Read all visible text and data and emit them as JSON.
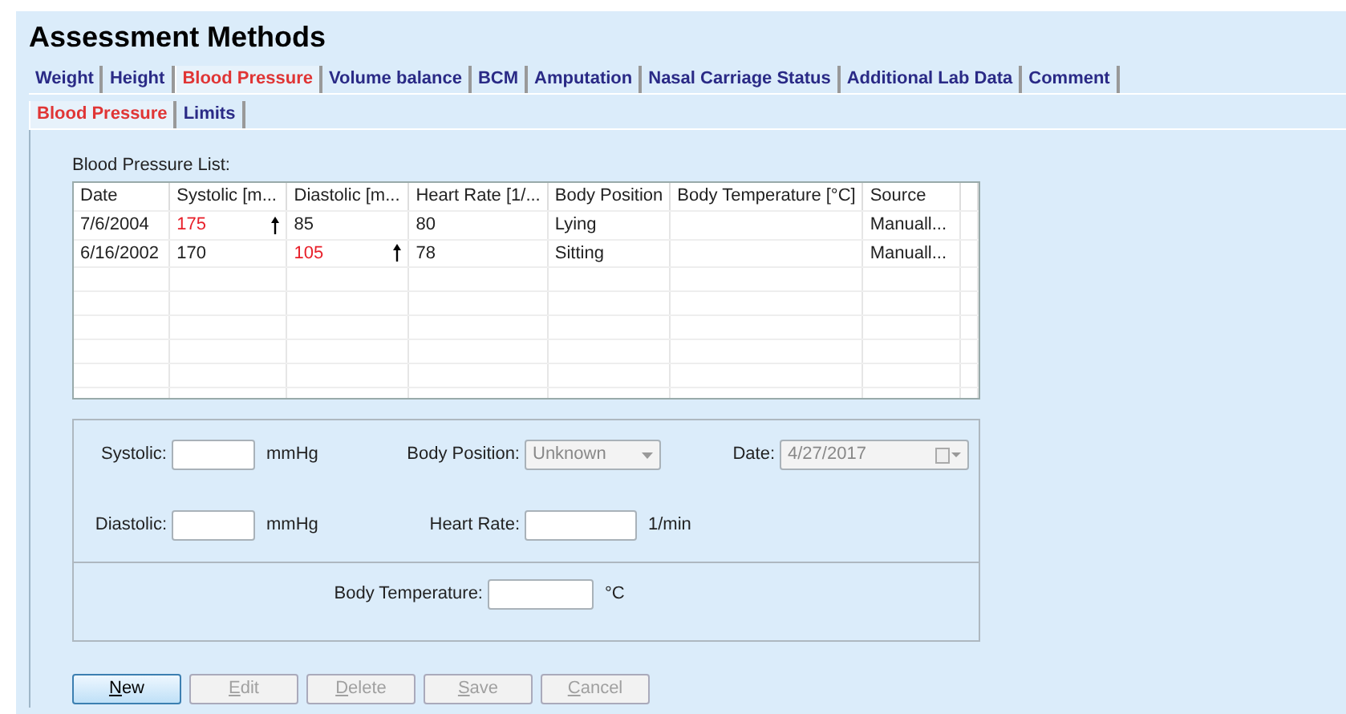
{
  "title": "Assessment Methods",
  "tabs": [
    {
      "label": "Weight",
      "selected": false
    },
    {
      "label": "Height",
      "selected": false
    },
    {
      "label": "Blood Pressure",
      "selected": true
    },
    {
      "label": "Volume balance",
      "selected": false
    },
    {
      "label": "BCM",
      "selected": false
    },
    {
      "label": "Amputation",
      "selected": false
    },
    {
      "label": "Nasal Carriage Status",
      "selected": false
    },
    {
      "label": "Additional Lab Data",
      "selected": false
    },
    {
      "label": "Comment",
      "selected": false
    }
  ],
  "subtabs": [
    {
      "label": "Blood Pressure",
      "selected": true
    },
    {
      "label": "Limits",
      "selected": false
    }
  ],
  "list_label": "Blood Pressure List:",
  "table": {
    "columns": [
      "Date",
      "Systolic [m...",
      "Diastolic [m...",
      "Heart Rate [1/...",
      "Body Position",
      "Body Temperature [°C]",
      "Source"
    ],
    "rows": [
      {
        "cells": [
          {
            "text": "7/6/2004",
            "high": false
          },
          {
            "text": "175",
            "high": true
          },
          {
            "text": "85",
            "high": false
          },
          {
            "text": "80",
            "high": false
          },
          {
            "text": "Lying",
            "high": false
          },
          {
            "text": "",
            "high": false
          },
          {
            "text": "Manuall...",
            "high": false
          }
        ]
      },
      {
        "cells": [
          {
            "text": "6/16/2002",
            "high": false
          },
          {
            "text": "170",
            "high": false
          },
          {
            "text": "105",
            "high": true
          },
          {
            "text": "78",
            "high": false
          },
          {
            "text": "Sitting",
            "high": false
          },
          {
            "text": "",
            "high": false
          },
          {
            "text": "Manuall...",
            "high": false
          }
        ]
      }
    ]
  },
  "form": {
    "rows": [
      [
        {
          "kind": "text",
          "label": "Systolic:",
          "unit": "mmHg"
        },
        {
          "kind": "select",
          "label": "Body Position:",
          "value": "Unknown",
          "disabled": true
        },
        {
          "kind": "date",
          "label": "Date:",
          "value": "4/27/2017",
          "disabled": true
        }
      ],
      [
        {
          "kind": "text",
          "label": "Diastolic:",
          "unit": "mmHg"
        },
        {
          "kind": "text",
          "label": "Heart Rate:",
          "unit": "1/min"
        }
      ]
    ],
    "temperature": {
      "kind": "text",
      "label": "Body Temperature:",
      "unit": "°C"
    }
  },
  "buttons": [
    {
      "label": "New",
      "disabled": false,
      "default": true
    },
    {
      "label": "Edit",
      "disabled": true,
      "default": false
    },
    {
      "label": "Delete",
      "disabled": true,
      "default": false
    },
    {
      "label": "Save",
      "disabled": true,
      "default": false
    },
    {
      "label": "Cancel",
      "disabled": true,
      "default": false
    }
  ]
}
